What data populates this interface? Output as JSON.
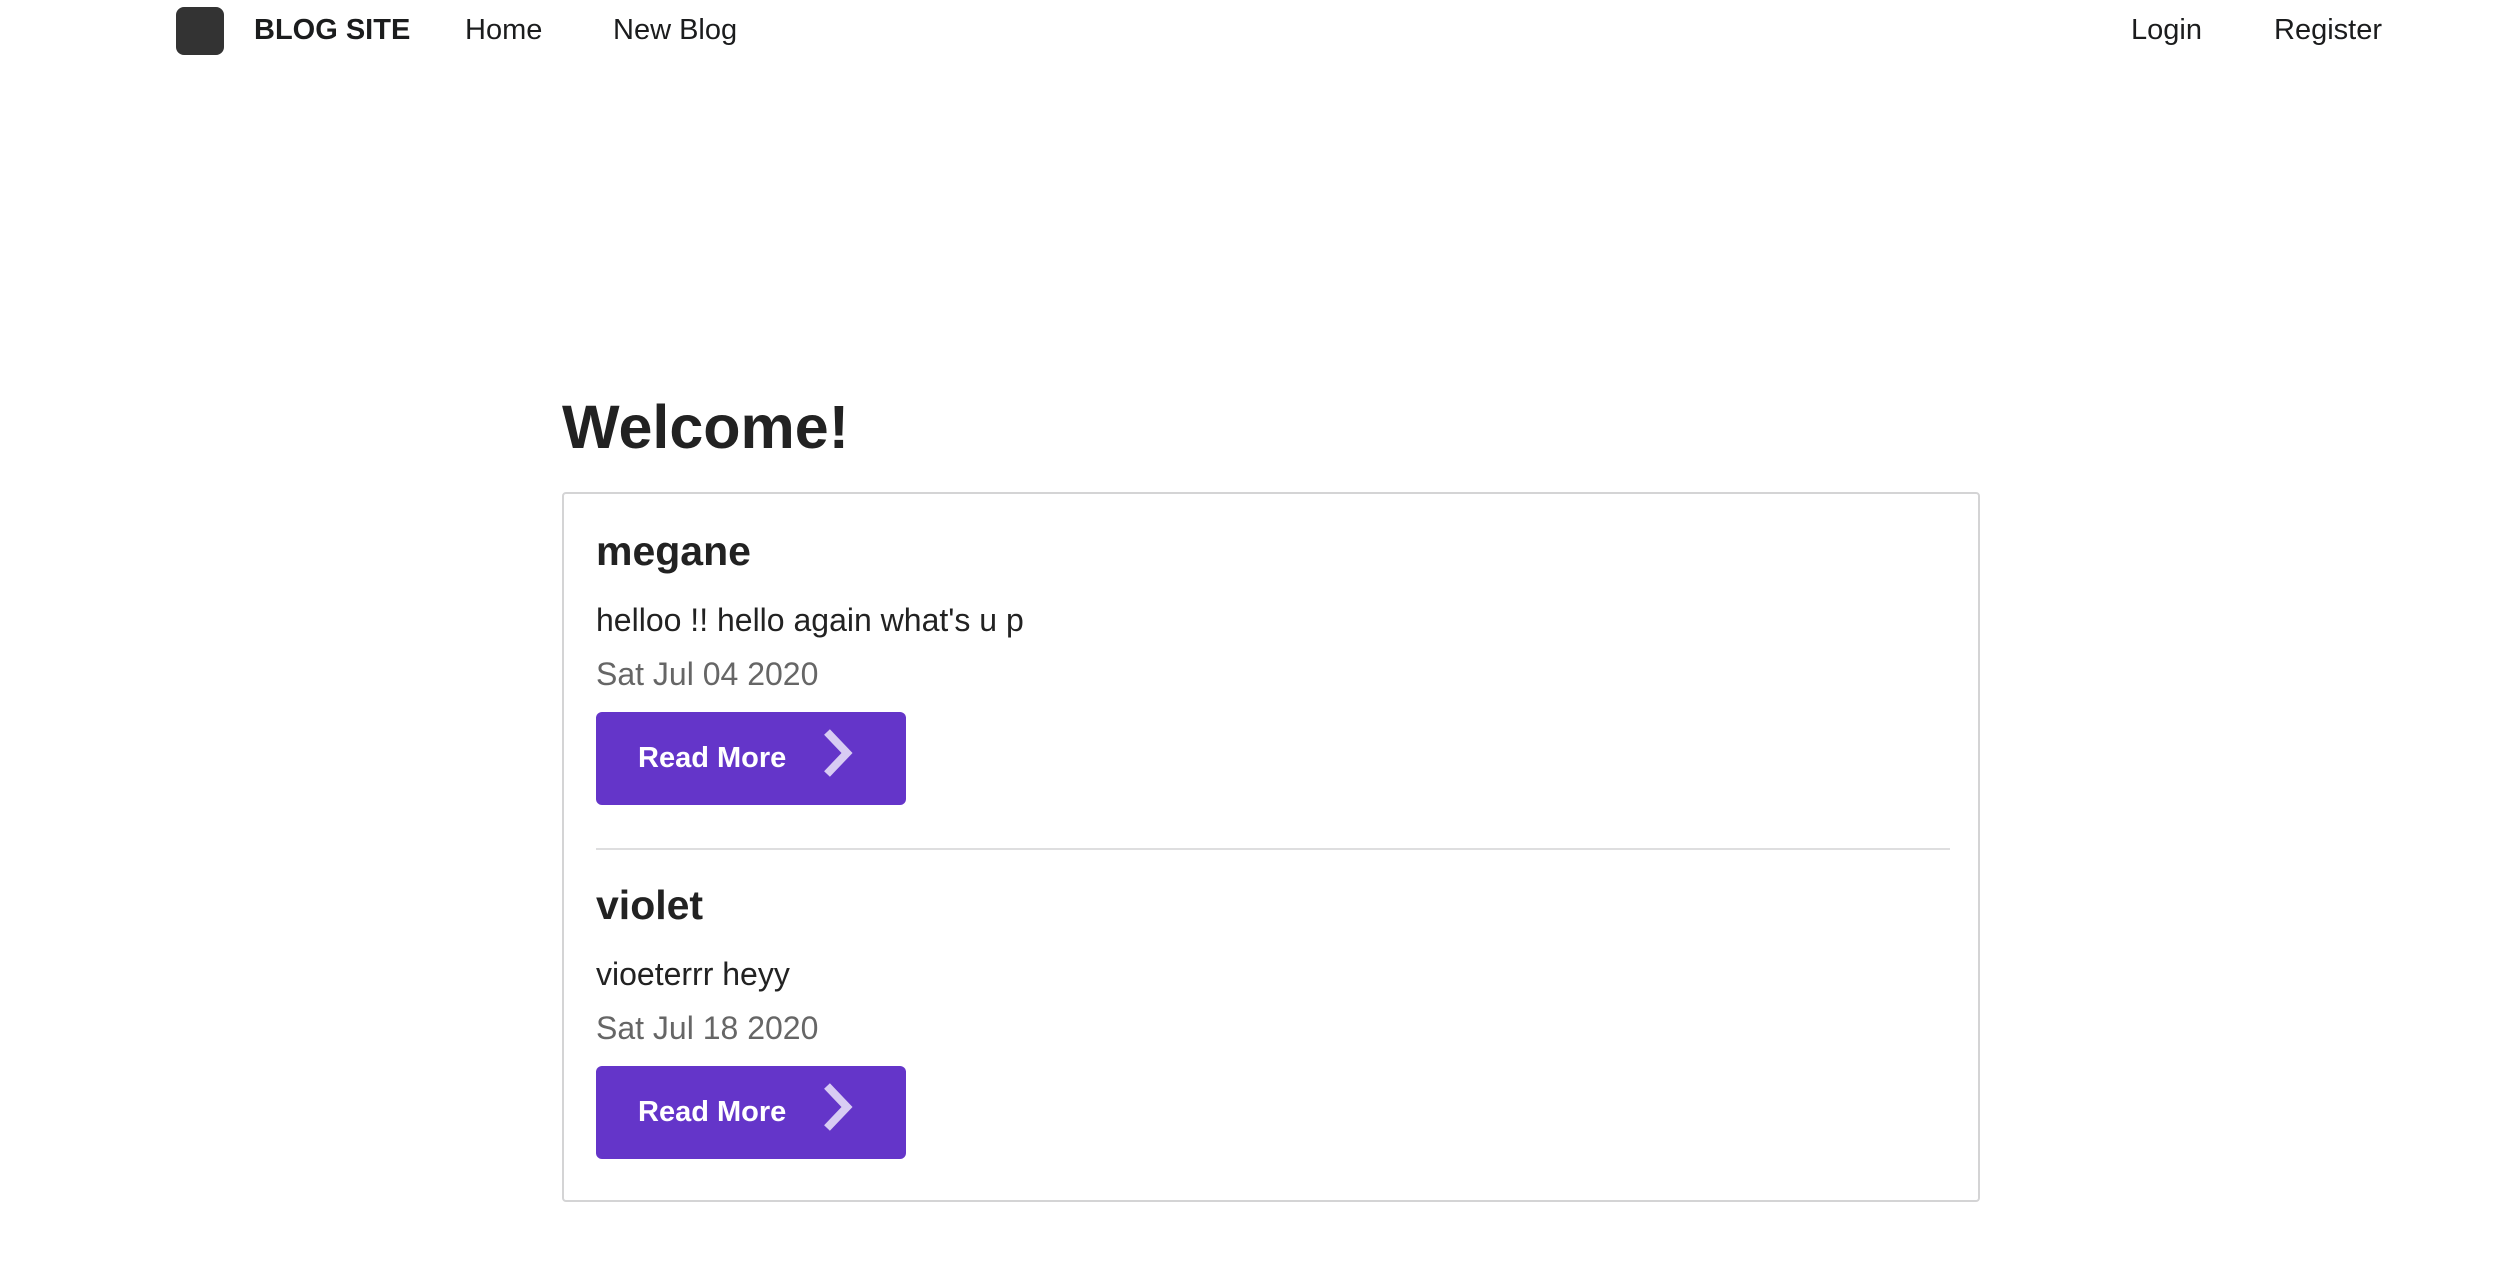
{
  "nav": {
    "brand": "BLOG SITE",
    "home": "Home",
    "new_blog": "New Blog",
    "login": "Login",
    "register": "Register"
  },
  "main": {
    "title": "Welcome!"
  },
  "posts": [
    {
      "author": "megane",
      "text": "helloo !! hello again what's u p",
      "date": "Sat Jul 04 2020",
      "button": "Read More"
    },
    {
      "author": "violet",
      "text": "vioeterrr heyy",
      "date": "Sat Jul 18 2020",
      "button": "Read More"
    }
  ],
  "colors": {
    "button": "#6435c9",
    "logo": "#333333"
  }
}
